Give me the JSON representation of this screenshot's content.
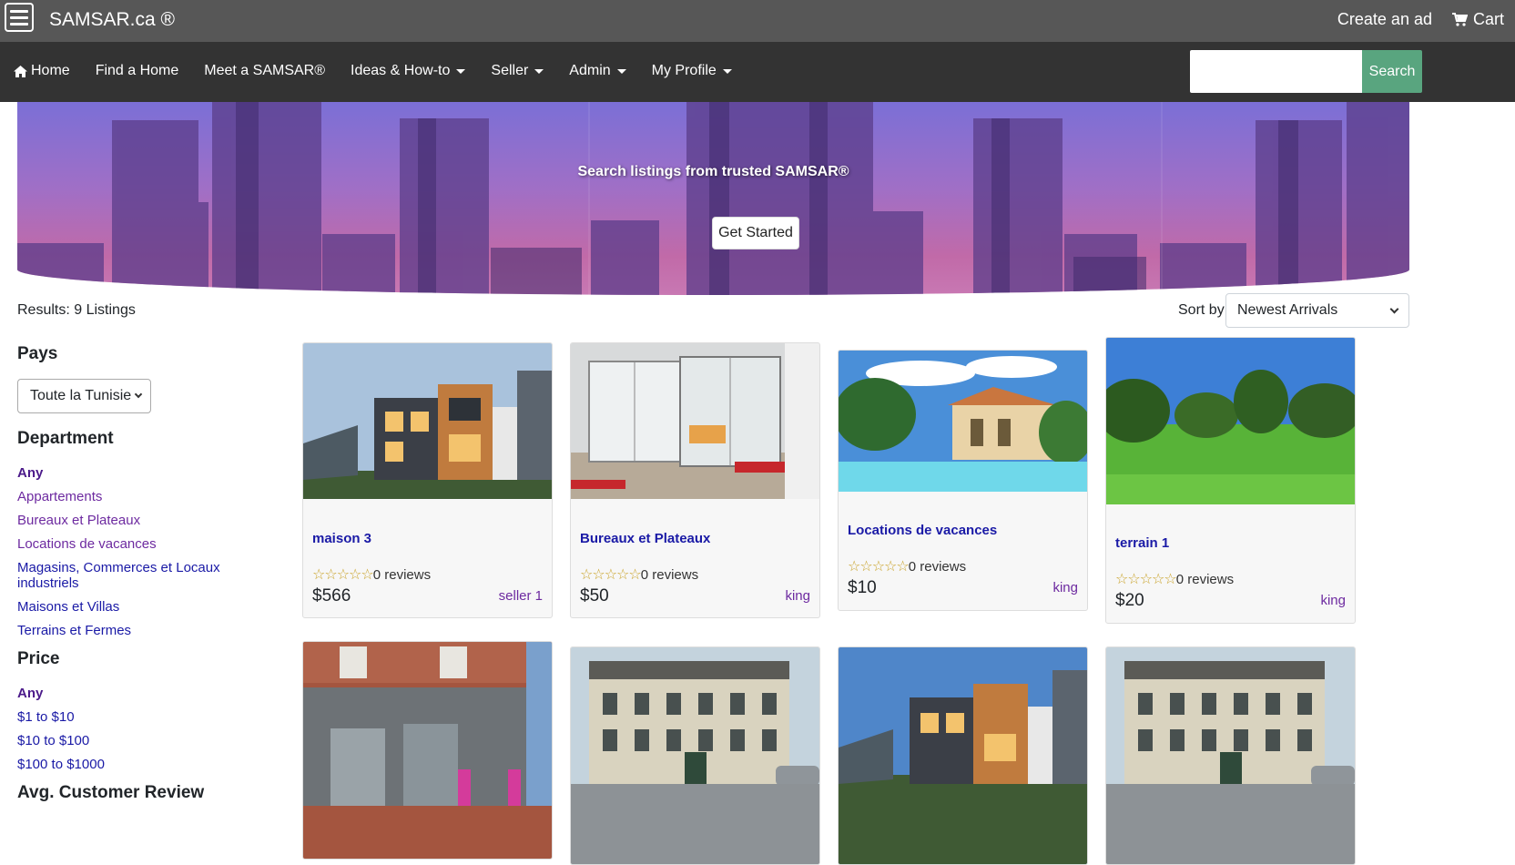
{
  "header": {
    "brand": "SAMSAR.ca ®",
    "create_ad": "Create an ad",
    "cart": "Cart"
  },
  "nav": {
    "home": "Home",
    "find_home": "Find a Home",
    "meet": "Meet a SAMSAR®",
    "ideas": "Ideas & How-to",
    "seller": "Seller",
    "admin": "Admin",
    "profile": "My Profile",
    "search_button": "Search",
    "search_value": ""
  },
  "hero": {
    "title": "Search listings from trusted SAMSAR®",
    "button": "Get Started"
  },
  "results": {
    "label": "Results:",
    "count": "9 Listings",
    "sort_label": "Sort by",
    "sort_value": "Newest Arrivals"
  },
  "sidebar": {
    "pays_heading": "Pays",
    "pays_value": "Toute la Tunisie",
    "department_heading": "Department",
    "departments": [
      "Any",
      "Appartements",
      "Bureaux et Plateaux",
      "Locations de vacances",
      "Magasins, Commerces et Locaux industriels",
      "Maisons et Villas",
      "Terrains et Fermes"
    ],
    "price_heading": "Price",
    "prices": [
      "Any",
      "$1 to $10",
      "$10 to $100",
      "$100 to $1000"
    ],
    "review_heading": "Avg. Customer Review"
  },
  "listings": [
    {
      "title": "maison 3",
      "reviews": "0 reviews",
      "price": "$566",
      "seller": "seller 1",
      "rating": 0
    },
    {
      "title": "Bureaux et Plateaux",
      "reviews": "0 reviews",
      "price": "$50",
      "seller": "king",
      "rating": 0
    },
    {
      "title": "Locations de vacances",
      "reviews": "0 reviews",
      "price": "$10",
      "seller": "king",
      "rating": 0
    },
    {
      "title": "terrain 1",
      "reviews": "0 reviews",
      "price": "$20",
      "seller": "king",
      "rating": 0
    }
  ],
  "colors": {
    "topbar": "#575757",
    "navbar": "#333333",
    "search_button": "#59a57f",
    "link": "#1a1aa6",
    "seller_link": "#6d2aa0"
  }
}
